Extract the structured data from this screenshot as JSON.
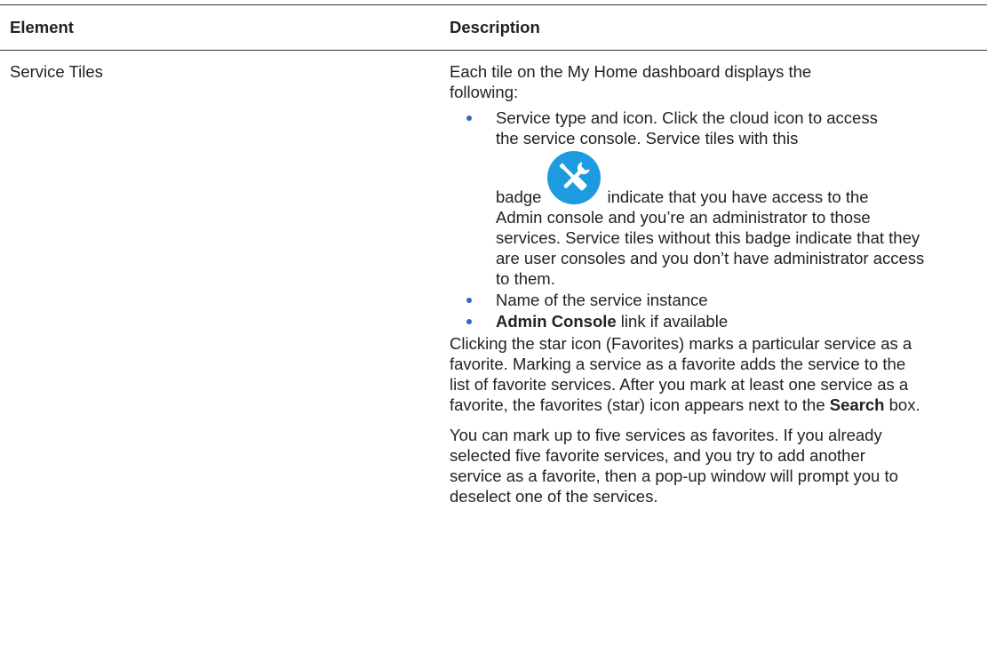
{
  "table": {
    "headers": {
      "element": "Element",
      "description": "Description"
    },
    "rows": [
      {
        "element": "Service Tiles",
        "intro": "Each tile on the My Home dashboard displays the following:",
        "bullet_1": {
          "part_a": "Service type and icon. Click the cloud icon to access the service console. Service tiles with this",
          "badge_word": "badge",
          "badge_icon": "wrench-screwdriver-admin-badge-icon",
          "part_b": "indicate that you have access to the",
          "part_c": "Admin console and you’re an administrator to those services. Service tiles without this badge indicate that they are user consoles and you don’t have administrator access to them."
        },
        "bullet_2": "Name of the service instance",
        "bullet_3": {
          "bold": "Admin Console",
          "rest": " link if available"
        },
        "para_1": {
          "before": "Clicking the star icon (Favorites) marks a particular service as a favorite. Marking a service as a favorite adds the service to the list of favorite services. After you mark at least one service as a favorite, the favorites (star) icon appears next to the ",
          "bold": "Search",
          "after": " box."
        },
        "para_2": "You can mark up to five services as favorites. If you already selected five favorite services, and you try to add another service as a favorite, then a pop-up window will prompt you to deselect one of the services."
      }
    ]
  },
  "colors": {
    "bullet": "#2e6ab8",
    "badge_fill": "#1e9be0",
    "rule": "#333333",
    "text": "#222222"
  }
}
